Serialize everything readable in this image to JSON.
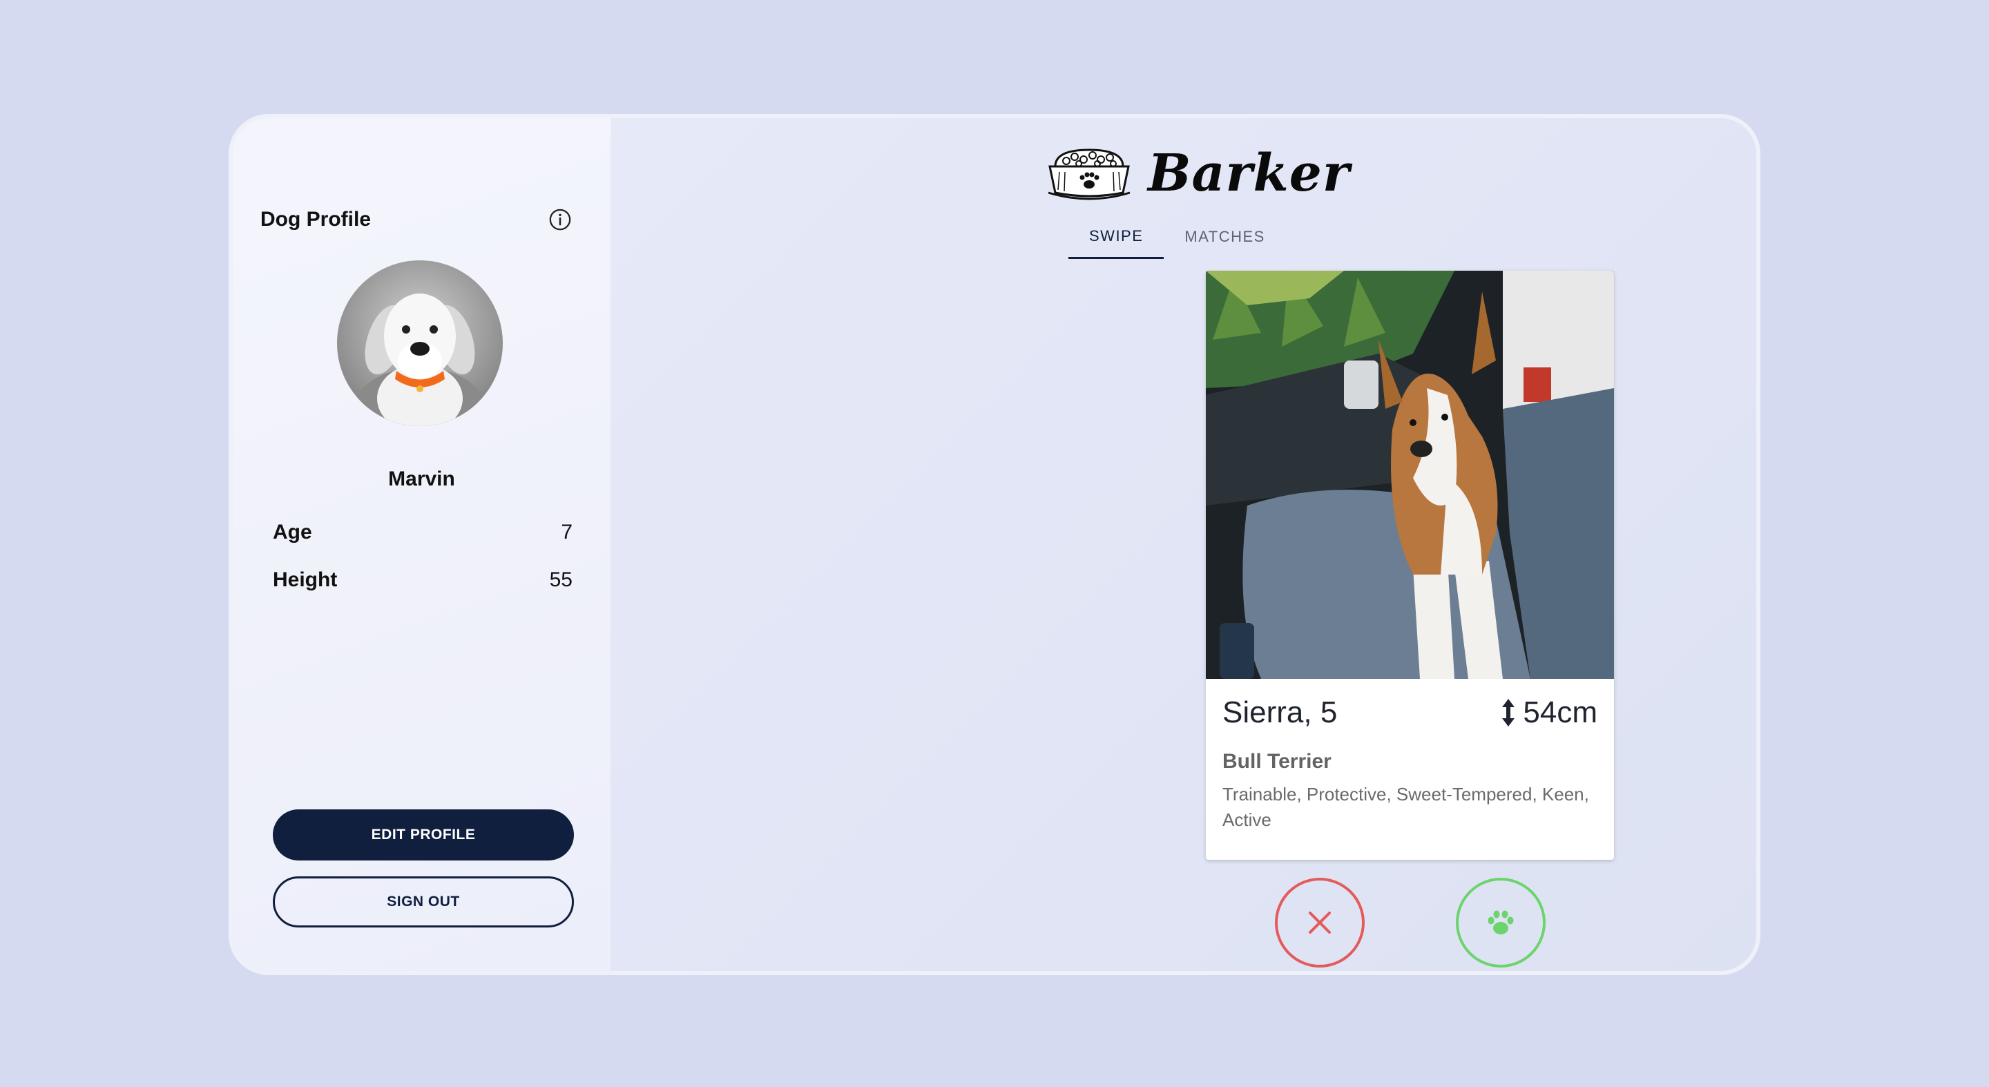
{
  "sidebar": {
    "title": "Dog Profile",
    "dog_name": "Marvin",
    "stats": [
      {
        "label": "Age",
        "value": "7"
      },
      {
        "label": "Height",
        "value": "55"
      }
    ],
    "edit_label": "EDIT PROFILE",
    "signout_label": "SIGN OUT"
  },
  "main": {
    "logo_text": "Barker",
    "tabs": [
      {
        "label": "SWIPE",
        "active": true
      },
      {
        "label": "MATCHES",
        "active": false
      }
    ],
    "card": {
      "title": "Sierra, 5",
      "height": "54cm",
      "breed": "Bull Terrier",
      "traits": "Trainable, Protective, Sweet-Tempered, Keen, Active"
    }
  },
  "colors": {
    "background": "#d5daf0",
    "primary": "#0f1f3d",
    "dislike": "#e35b5b",
    "like": "#6cd46c"
  },
  "icons": {
    "info": "info-circle-icon",
    "logo": "dog-bowl-paw-icon",
    "height": "vertical-arrows-icon",
    "dislike": "close-icon",
    "like": "paw-icon"
  }
}
